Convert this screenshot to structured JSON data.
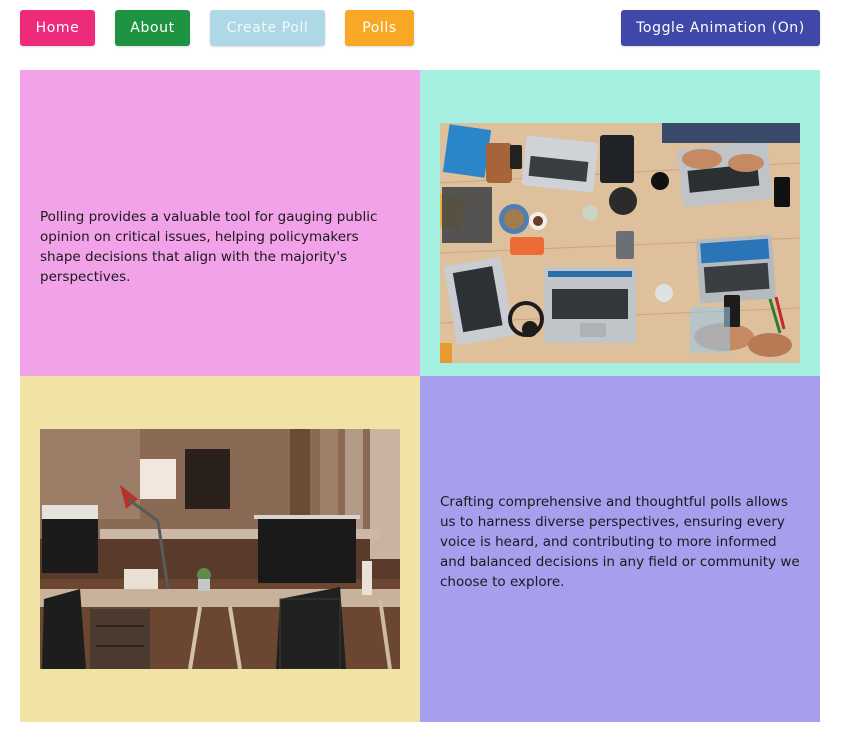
{
  "nav": {
    "home_label": "Home",
    "about_label": "About",
    "create_poll_label": "Create Poll",
    "polls_label": "Polls",
    "toggle_animation_label": "Toggle Animation (On)"
  },
  "colors": {
    "home": "#ee2a7b",
    "about": "#1e9443",
    "create_poll": "#add8e6",
    "polls": "#f8a825",
    "toggle": "#3f48a8",
    "panel_pink": "#f1a2e8",
    "panel_mint": "#a5f0e1",
    "panel_sand": "#f1e2a6",
    "panel_lavender": "#a59fee"
  },
  "panels": {
    "top_left_text": "Polling provides a valuable tool for gauging public opinion on critical issues, helping policymakers shape decisions that align with the majority's perspectives.",
    "top_right_image": "photo-laptops-meeting-table",
    "bottom_left_image": "photo-empty-office-workspace",
    "bottom_right_text": "Crafting comprehensive and thoughtful polls allows us to harness diverse perspectives, ensuring every voice is heard, and contributing to more informed and balanced decisions in any field or community we choose to explore."
  }
}
